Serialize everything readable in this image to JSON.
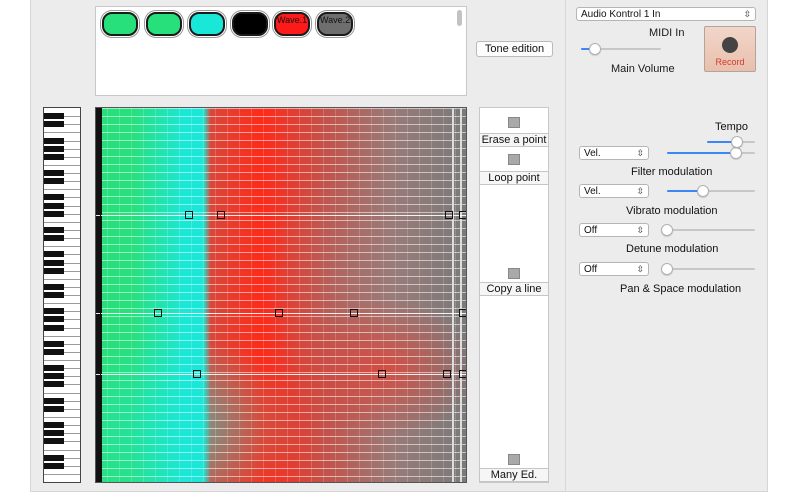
{
  "palette": {
    "swatches": [
      {
        "color": "#27e07c",
        "label": ""
      },
      {
        "color": "#27e07c",
        "label": ""
      },
      {
        "color": "#19e8d8",
        "label": ""
      },
      {
        "color": "#000000",
        "label": ""
      },
      {
        "color": "#ff1a1a",
        "label": "Wave.1"
      },
      {
        "color": "#6e6e6e",
        "label": "Wave.2"
      }
    ]
  },
  "tone_button": "Tone edition",
  "tools": {
    "erase": "Erase a point",
    "loop": "Loop point",
    "copy": "Copy a line",
    "many": "Many Ed."
  },
  "audio": {
    "device": "Audio Kontrol 1 In",
    "midi_label": "MIDI In",
    "main_volume_label": "Main Volume",
    "record_label": "Record",
    "main_volume_level": 0.18
  },
  "modulation": {
    "tempo_label": "Tempo",
    "tempo_level": 0.62,
    "rows": [
      {
        "value": "Vel.",
        "label": "Filter modulation",
        "level": 0.78
      },
      {
        "value": "Vel.",
        "label": "Vibrato modulation",
        "level": 0.41
      },
      {
        "value": "Off",
        "label": "Detune modulation",
        "level": 0.0
      },
      {
        "value": "Off",
        "label": "Pan & Space modulation",
        "level": 0.0
      }
    ]
  },
  "colors": {
    "accent": "#3d86f5",
    "record_text": "#d23b2e",
    "green": "#27e07c",
    "cyan": "#19e8d8",
    "red": "#ff2a1a",
    "gray": "#7a7a7a"
  }
}
